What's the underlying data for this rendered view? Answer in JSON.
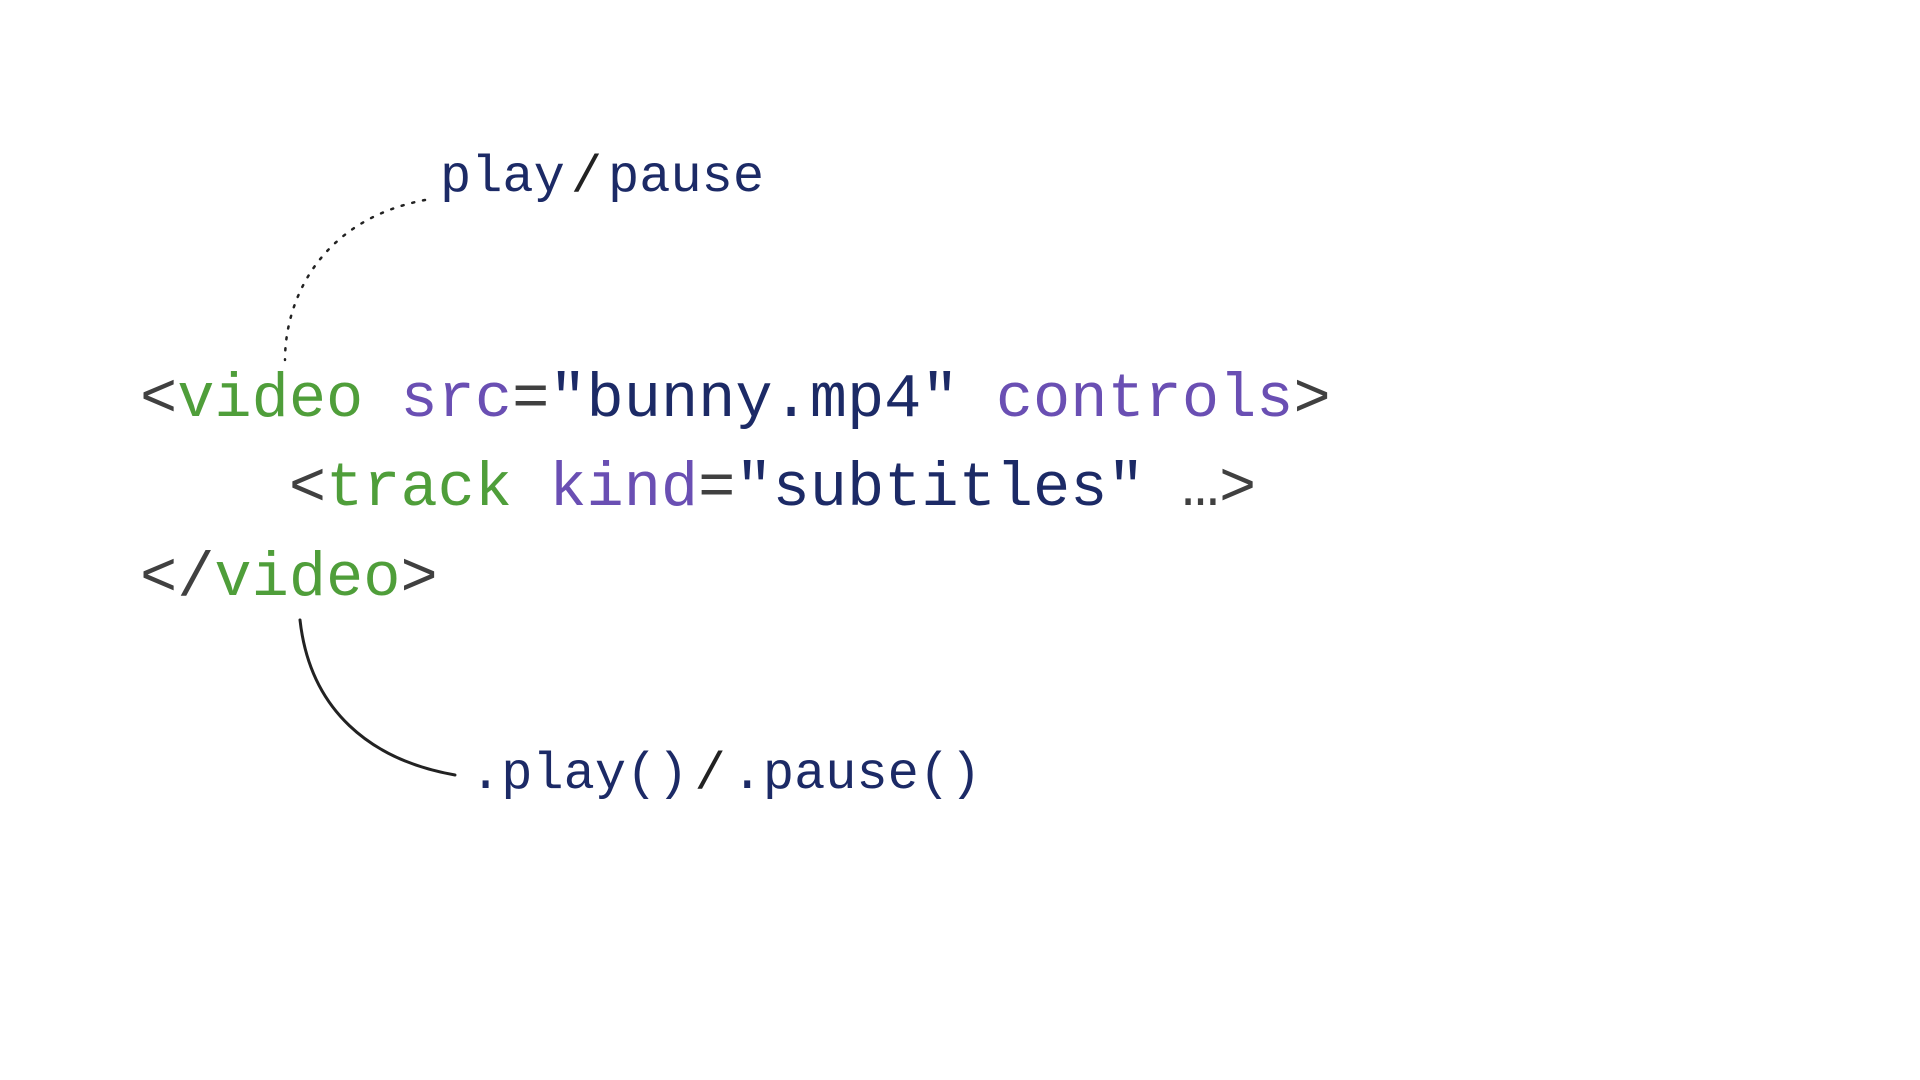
{
  "annotations": {
    "top": {
      "a": "play",
      "sep": "/",
      "b": "pause"
    },
    "bottom": {
      "a": ".play()",
      "sep": "/",
      "b": ".pause()"
    }
  },
  "code": {
    "l1": {
      "open": "<",
      "tag": "video",
      "sp1": " ",
      "attr1": "src",
      "eq1": "=",
      "q1a": "\"",
      "val1": "bunny.mp4",
      "q1b": "\"",
      "sp2": " ",
      "attr2": "controls",
      "close": ">"
    },
    "l2": {
      "indent": "    ",
      "open": "<",
      "tag": "track",
      "sp1": " ",
      "attr1": "kind",
      "eq1": "=",
      "q1a": "\"",
      "val1": "subtitles",
      "q1b": "\"",
      "tail": " …>"
    },
    "l3": {
      "open": "</",
      "tag": "video",
      "close": ">"
    }
  }
}
